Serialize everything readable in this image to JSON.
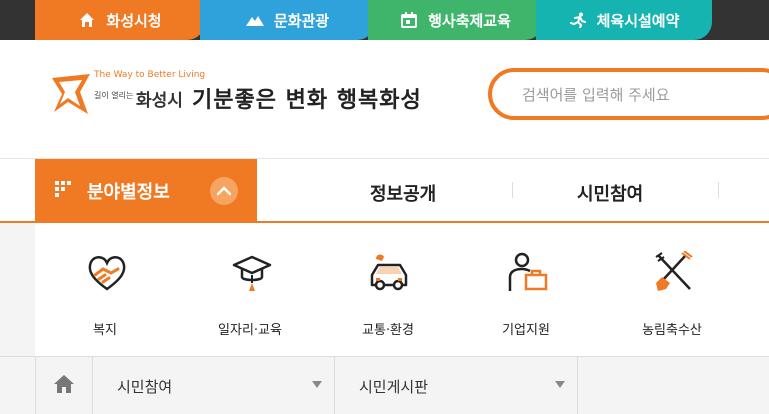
{
  "top_tabs": [
    {
      "label": "화성시청",
      "icon": "home-icon",
      "color": "#f07a23"
    },
    {
      "label": "문화관광",
      "icon": "mountain-icon",
      "color": "#2fa2db"
    },
    {
      "label": "행사축제교육",
      "icon": "calendar-icon",
      "color": "#3fb56b"
    },
    {
      "label": "체육시설예약",
      "icon": "runner-icon",
      "color": "#16b4b0"
    }
  ],
  "header": {
    "logo_tagline": "The Way to Better Living",
    "logo_small": "길이 열리는",
    "logo_name": "화성시",
    "slogan": "기분좋은 변화 행복화성"
  },
  "search": {
    "placeholder": "검색어를 입력해 주세요"
  },
  "nav": {
    "menu_label": "분야별정보",
    "items": [
      "정보공개",
      "시민참여"
    ]
  },
  "categories": [
    {
      "label": "복지",
      "icon": "heart-handshake-icon"
    },
    {
      "label": "일자리·교육",
      "icon": "graduation-cap-icon"
    },
    {
      "label": "교통·환경",
      "icon": "car-icon"
    },
    {
      "label": "기업지원",
      "icon": "businessman-icon"
    },
    {
      "label": "농림축수산",
      "icon": "shovel-fork-icon"
    }
  ],
  "breadcrumb": {
    "home_icon": "home-icon",
    "items": [
      "시민참여",
      "시민게시판"
    ]
  },
  "colors": {
    "accent": "#f07a23",
    "topbar": "#333333"
  }
}
